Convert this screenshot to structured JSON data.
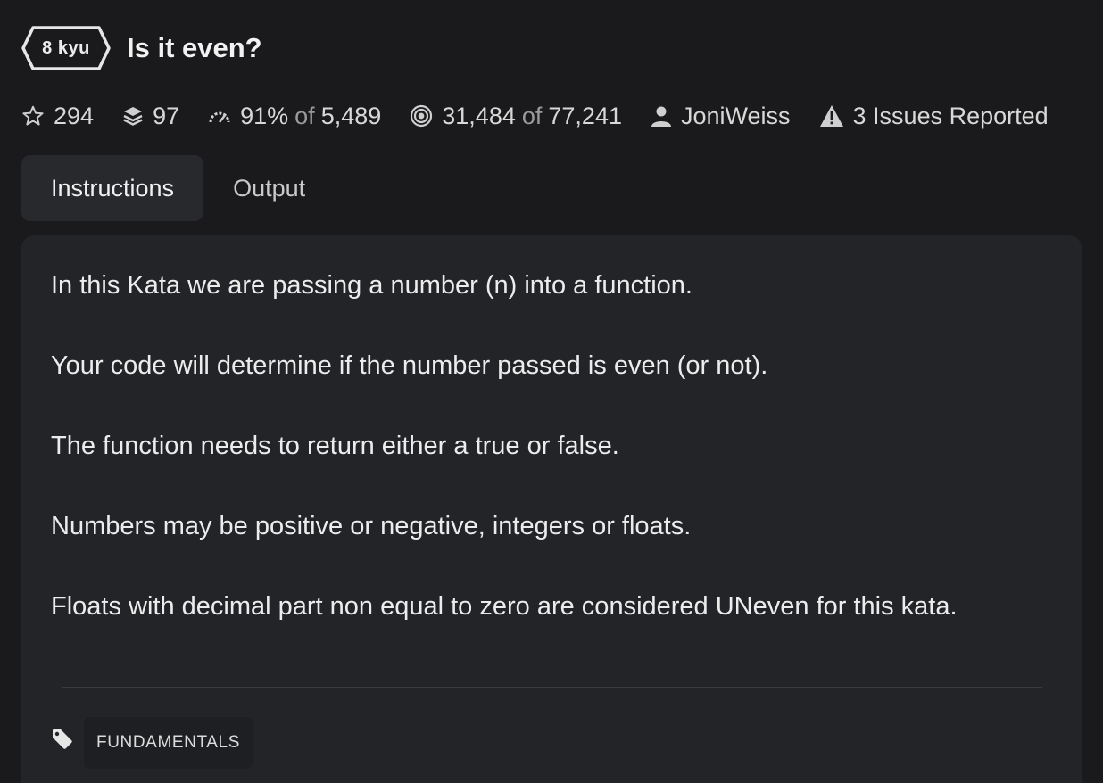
{
  "header": {
    "rank": "8 kyu",
    "title": "Is it even?"
  },
  "stats": {
    "stars": "294",
    "collections": "97",
    "satisfaction_percent": "91%",
    "satisfaction_of": "of",
    "satisfaction_votes": "5,489",
    "completed": "31,484",
    "completed_of": "of",
    "attempted": "77,241",
    "author": "JoniWeiss",
    "issues": "3 Issues Reported"
  },
  "tabs": [
    {
      "label": "Instructions",
      "active": true
    },
    {
      "label": "Output",
      "active": false
    }
  ],
  "description": [
    "In this Kata we are passing a number (n) into a function.",
    "Your code will determine if the number passed is even (or not).",
    "The function needs to return either a true or false.",
    "Numbers may be positive or negative, integers or floats.",
    "Floats with decimal part non equal to zero are considered UNeven for this kata."
  ],
  "tags": [
    "FUNDAMENTALS"
  ],
  "icons": {
    "stars": "star-icon",
    "collections": "layers-icon",
    "satisfaction": "gauge-icon",
    "completed": "target-icon",
    "author": "user-icon",
    "issues": "warning-icon",
    "tags": "tag-icon"
  },
  "colors": {
    "background": "#1a1a1c",
    "panel": "#232428",
    "active_tab": "#28292d",
    "text": "#ececec",
    "muted": "#9a9a9a"
  }
}
